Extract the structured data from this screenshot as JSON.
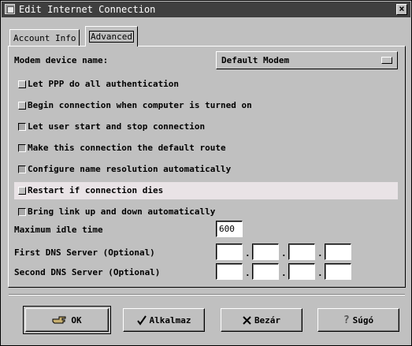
{
  "window": {
    "title": "Edit Internet Connection",
    "close_glyph": "×"
  },
  "tabs": [
    {
      "label": "Account Info",
      "active": false
    },
    {
      "label": "Advanced",
      "active": true
    }
  ],
  "modem": {
    "label": "Modem device name:",
    "value": "Default Modem"
  },
  "options": [
    {
      "label": "Let PPP do all authentication",
      "checked": false
    },
    {
      "label": "Begin connection when computer is turned on",
      "checked": false
    },
    {
      "label": "Let user start and stop connection",
      "checked": true
    },
    {
      "label": "Make this connection the default route",
      "checked": true
    },
    {
      "label": "Configure name resolution automatically",
      "checked": true
    },
    {
      "label": "Restart if connection dies",
      "checked": false
    },
    {
      "label": "Bring link up and down automatically",
      "checked": true
    }
  ],
  "idle": {
    "label": "Maximum idle time",
    "value": "600"
  },
  "dns1": {
    "label": "First DNS Server (Optional)",
    "octets": [
      "",
      "",
      "",
      ""
    ]
  },
  "dns2": {
    "label": "Second DNS Server (Optional)",
    "octets": [
      "",
      "",
      "",
      ""
    ]
  },
  "buttons": {
    "ok": {
      "label": "OK",
      "icon": "hand-pointing-icon"
    },
    "apply": {
      "label": "Alkalmaz",
      "icon": "checkmark-icon"
    },
    "close": {
      "label": "Bezár",
      "icon": "x-icon"
    },
    "help": {
      "label": "Súgó",
      "icon": "question-icon"
    }
  }
}
